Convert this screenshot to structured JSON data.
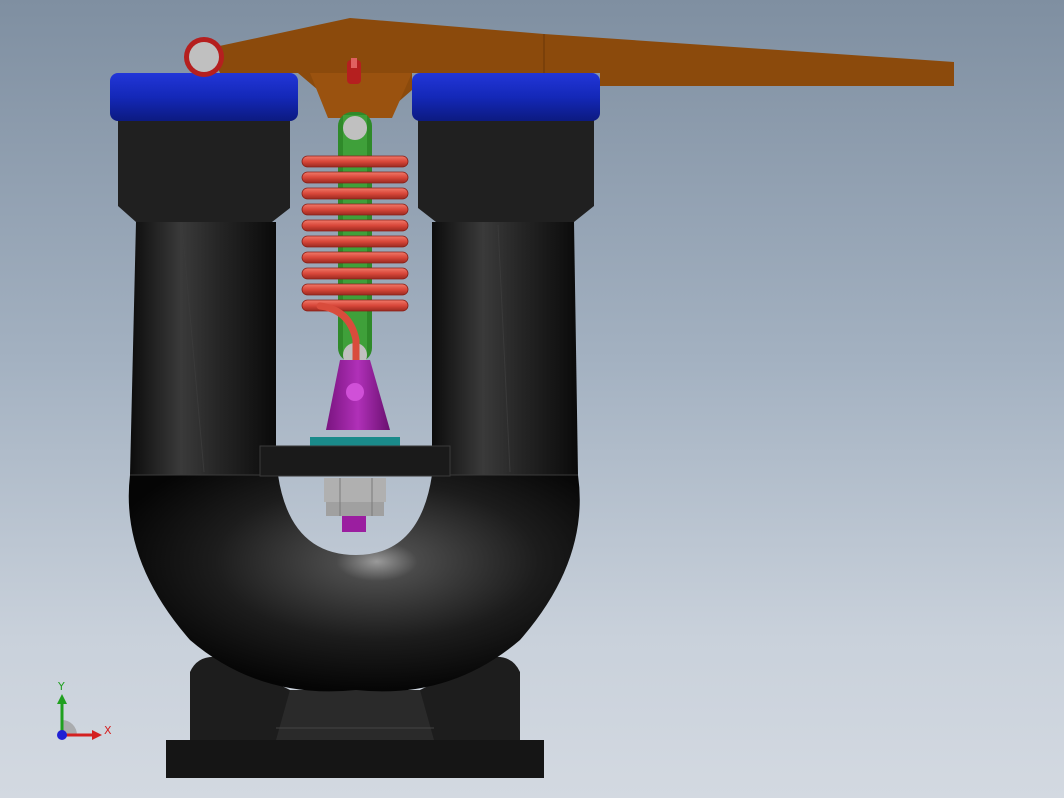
{
  "viewport": {
    "background_top": "#7f8fa1",
    "background_bottom": "#d3d9e1"
  },
  "parts": {
    "body_color": "#1e1e1e",
    "cap_color": "#1a2fc8",
    "lever_color": "#8b4a0c",
    "spring_color": "#d94c3c",
    "link_color": "#2f8a2a",
    "bracket_color": "#9b1ea0",
    "washer_color": "#1a8a8a",
    "nut_color": "#b0b0b0",
    "pin_color": "#c0c0c0",
    "pin_red_color": "#b51f1f"
  },
  "triad": {
    "x_label": "X",
    "y_label": "Y",
    "x_color": "#d42020",
    "y_color": "#20a020",
    "z_color": "#2020d4"
  }
}
